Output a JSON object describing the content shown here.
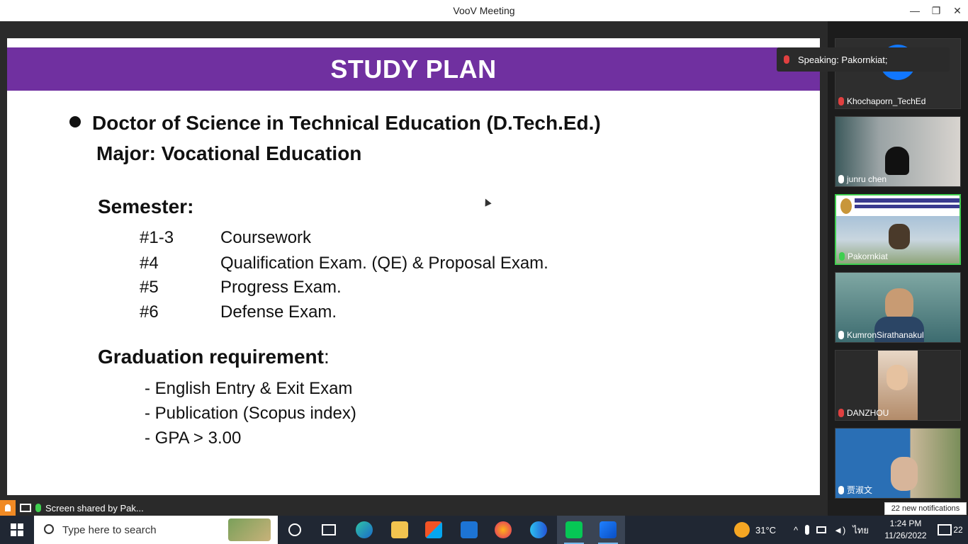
{
  "window": {
    "title": "VooV Meeting",
    "controls": {
      "minimize": "—",
      "maximize": "❐",
      "close": "✕"
    }
  },
  "slide": {
    "header": "STUDY PLAN",
    "degree": "Doctor of Science in Technical Education (D.Tech.Ed.)",
    "major": "Major: Vocational Education",
    "semester_heading": "Semester:",
    "semesters": [
      {
        "num": "#1-3",
        "text": "Coursework"
      },
      {
        "num": "#4",
        "text": "Qualification Exam. (QE) & Proposal Exam."
      },
      {
        "num": "#5",
        "text": "Progress Exam."
      },
      {
        "num": "#6",
        "text": "Defense Exam."
      }
    ],
    "grad_heading": "Graduation requirement",
    "grad_colon": ":",
    "requirements": [
      "-  English Entry & Exit Exam",
      "-  Publication (Scopus index)",
      "-  GPA > 3.00"
    ]
  },
  "speaking": {
    "text": "Speaking: Pakornkiat;"
  },
  "participants": [
    {
      "name": "Khochaporn_TechEd",
      "mic": "muted",
      "bg": "#2e2e2e"
    },
    {
      "name": "junru  chen",
      "mic": "on",
      "bg": "#6f7b7f"
    },
    {
      "name": "Pakornkiat",
      "mic": "active",
      "bg": "#b6c8d8"
    },
    {
      "name": "KumronSirathanakul",
      "mic": "on",
      "bg": "#5a8a8f"
    },
    {
      "name": "DANZHOU",
      "mic": "muted",
      "bg": "#2b2b2b"
    },
    {
      "name": "贾淑文",
      "mic": "on",
      "bg": "#2a6fb5"
    }
  ],
  "share": {
    "text": "Screen shared by Pak..."
  },
  "notification_toast": "22 new notifications",
  "taskbar": {
    "search_placeholder": "Type here to search",
    "weather": "31°C",
    "language": "ไทย",
    "time": "1:24 PM",
    "date": "11/26/2022",
    "notif_count": "22"
  },
  "colors": {
    "slide_header": "#7030a0",
    "taskbar": "#202733",
    "active_mic": "#3fcf4f",
    "muted_mic": "#e04040"
  }
}
